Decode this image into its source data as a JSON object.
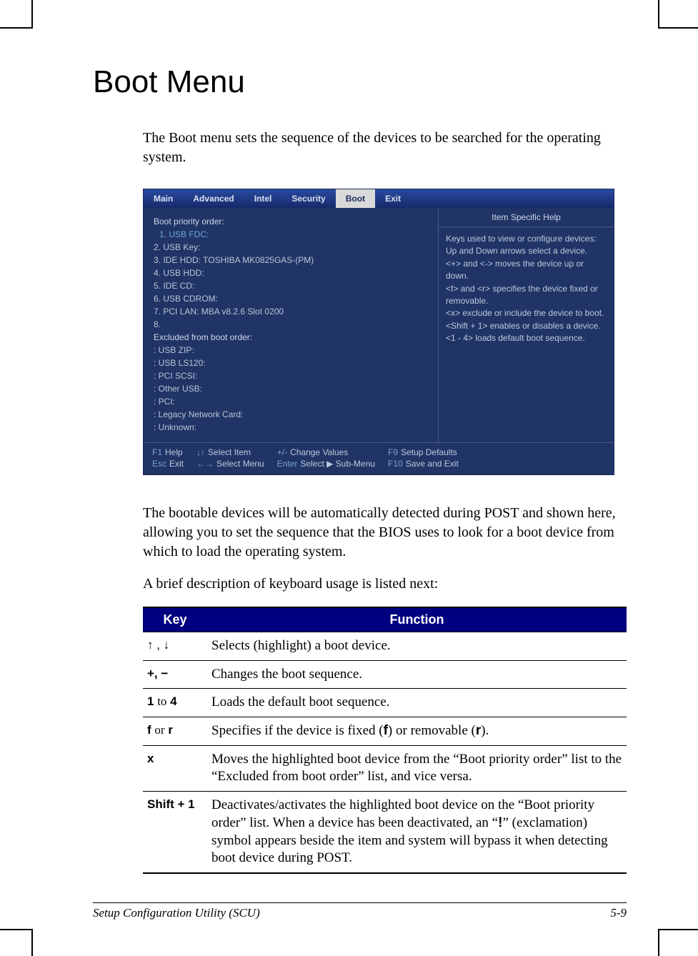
{
  "heading": "Boot Menu",
  "intro": "The Boot menu sets the sequence of the devices to be searched for the operating system.",
  "bios": {
    "tabs": [
      "Main",
      "Advanced",
      "Intel",
      "Security",
      "Boot",
      "Exit"
    ],
    "active_tab": "Boot",
    "left": {
      "title": "Boot priority order:",
      "selected": "1. USB FDC:",
      "items": [
        "2. USB Key:",
        "3. IDE HDD: TOSHIBA MK0825GAS-(PM)",
        "4. USB HDD:",
        "5. IDE CD:",
        "6. USB CDROM:",
        "7. PCI LAN: MBA v8.2.6 Slot 0200",
        "8."
      ],
      "excluded_title": "Excluded from boot order:",
      "excluded": [
        ": USB ZIP:",
        ": USB LS120:",
        ": PCI SCSI:",
        ": Other USB:",
        ": PCI:",
        ": Legacy Network Card:",
        ": Unknown:"
      ]
    },
    "right": {
      "title": "Item Specific Help",
      "body": "Keys used to view or configure devices:\nUp and Down arrows select a device.\n<+> and <-> moves the device up or down.\n<f> and <r> specifies the device fixed or removable.\n<x> exclude or include the device to boot.\n<Shift + 1> enables or disables a device.\n<1 - 4> loads default boot sequence."
    },
    "footer": {
      "f1": "F1",
      "f1_label": "Help",
      "esc": "Esc",
      "esc_label": "Exit",
      "ud": "↓↑",
      "ud_label": "Select Item",
      "lr": "←→",
      "lr_label": "Select Menu",
      "pm": "+/-",
      "pm_label": "Change Values",
      "enter": "Enter",
      "enter_label": "Select ▶ Sub-Menu",
      "f9": "F9",
      "f9_label": "Setup Defaults",
      "f10": "F10",
      "f10_label": "Save and Exit"
    }
  },
  "para2": "The bootable devices will be automatically detected during POST and shown here, allowing you to set the sequence that the BIOS uses to look for a boot device from which to load the operating system.",
  "para3": "A brief description of keyboard usage is listed next:",
  "table": {
    "head_key": "Key",
    "head_func": "Function",
    "rows": [
      {
        "key": "↑ , ↓",
        "func": "Selects (highlight) a boot device."
      },
      {
        "key": "+, −",
        "func": "Changes the boot sequence."
      },
      {
        "key_html": "<span class='sans'>1</span> <span class='serif'>to</span> <span class='sans'>4</span>",
        "func": "Loads the default boot sequence."
      },
      {
        "key_html": "<span class='sans'>f</span> <span class='serif'>or</span> <span class='sans'>r</span>",
        "func_html": "Specifies if the device is fixed (<b style='font-family:Arial'>f</b>) or removable (<b style='font-family:Arial'>r</b>)."
      },
      {
        "key": "x",
        "func": "Moves the highlighted boot device from the “Boot priority order” list to the “Excluded from boot order” list, and vice versa."
      },
      {
        "key": "Shift + 1",
        "func_html": "Deactivates/activates the highlighted boot device on the “Boot priority order” list. When a device has been deactivated, an “<b style='font-family:Arial'>!</b>” (exclamation) symbol appears beside the item and system will bypass it when detecting boot device during POST."
      }
    ]
  },
  "footer_left": "Setup Configuration Utility (SCU)",
  "footer_right": "5-9"
}
